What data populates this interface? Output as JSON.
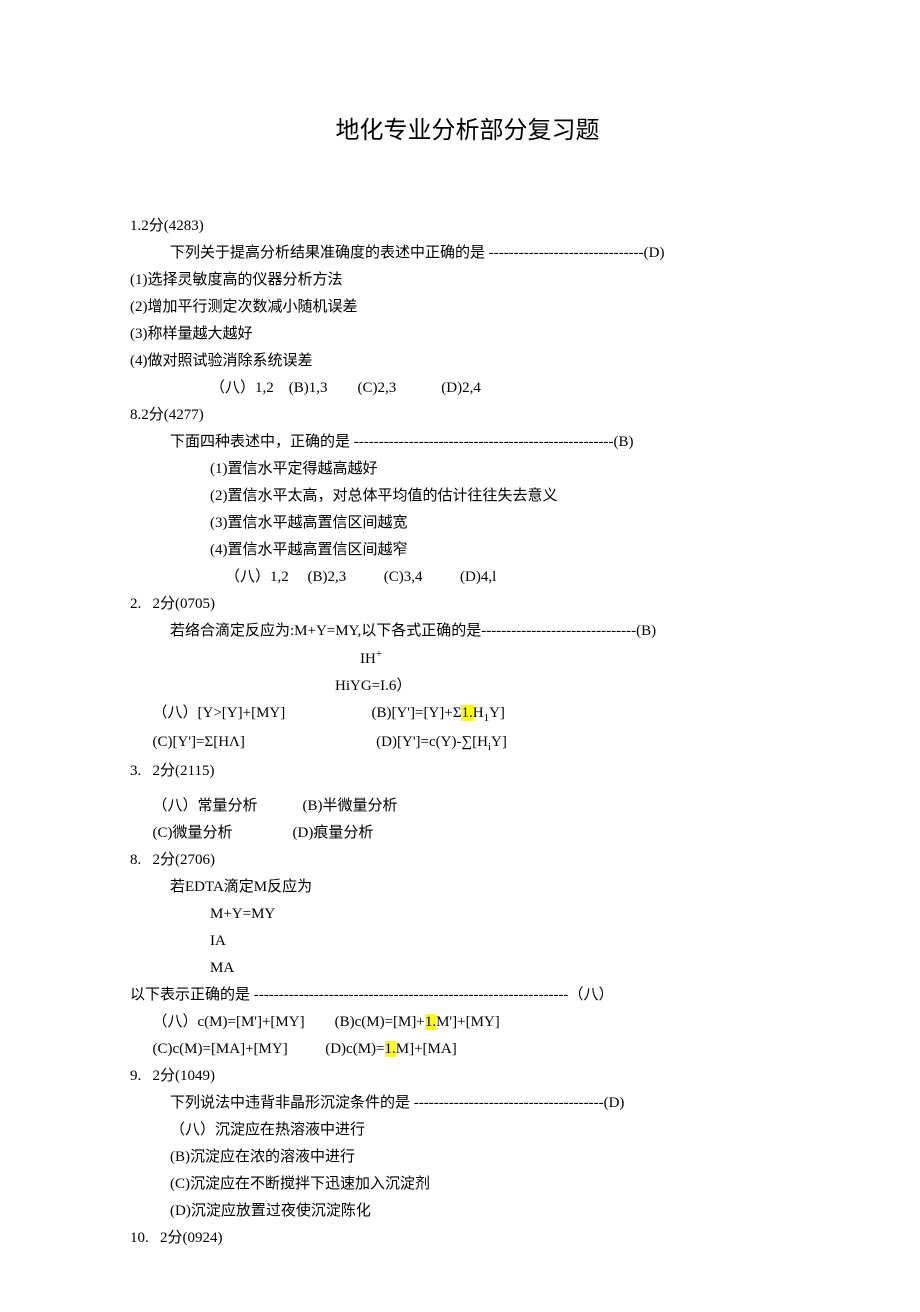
{
  "title": "地化专业分析部分复习题",
  "q1": {
    "header": "1.2分(4283)",
    "stem_prefix": "下列关于提高分析结果准确度的表述中正确的是 ",
    "stem_dash": "-------------------------------",
    "stem_ans": "(D)",
    "line1": "(1)选择灵敏度高的仪器分析方法",
    "line2": "(2)增加平行测定次数减小随机误差",
    "line3": "(3)称样量越大越好",
    "line4": "(4)做对照试验消除系统误差",
    "opts": "（八）1,2    (B)1,3        (C)2,3            (D)2,4"
  },
  "q8a": {
    "header": "8.2分(4277)",
    "stem_prefix": "下面四种表述中，正确的是 ",
    "stem_dash": "----------------------------------------------------",
    "stem_ans": "(B)",
    "line1": "(1)置信水平定得越高越好",
    "line2": "(2)置信水平太高，对总体平均值的估计往往失去意义",
    "line3": "(3)置信水平越高置信区间越宽",
    "line4": "(4)置信水平越高置信区间越窄",
    "opts": "（八）1,2     (B)2,3          (C)3,4          (D)4,l"
  },
  "q2": {
    "header": "2.   2分(0705)",
    "stem_prefix": "若络合滴定反应为:M+Y=MY,以下各式正确的是",
    "stem_dash": "-------------------------------",
    "stem_ans": "(B)",
    "mid1": "IH",
    "mid1_sup": "+",
    "mid2": "HiYG=I.6）",
    "optA_pre": "（八）[Y>[Y]+[MY]",
    "optB_pre": "(B)[Y']=[Y]+Σ",
    "optB_hl": "1.",
    "optB_post": "H",
    "optB_sub": "1",
    "optB_tail": "Y]",
    "optC": "(C)[Y']=Σ[HΛ]",
    "optD_pre": "(D)[Y']=c(Y)-∑[H",
    "optD_sub": "i",
    "optD_post": "Y]"
  },
  "q3": {
    "header": "3.   2分(2115)",
    "row1a": "（八）常量分析",
    "row1b": "(B)半微量分析",
    "row2a": "(C)微量分析",
    "row2b": "(D)痕量分析"
  },
  "q8b": {
    "header": "8.   2分(2706)",
    "stem": "若EDTA滴定M反应为",
    "l1": "M+Y=MY",
    "l2": "IA",
    "l3": "MA",
    "stem2_pre": "以下表示正确的是 ",
    "stem2_dash": "---------------------------------------------------------------",
    "stem2_ans": "（八）",
    "optA": "（八）c(M)=[M']+[MY]",
    "optB_pre": "(B)c(M)=[M]+",
    "optB_hl": "1.",
    "optB_post": "M']+[MY]",
    "optC": "(C)c(M)=[MA]+[MY]",
    "optD_pre": "(D)c(M)=",
    "optD_hl": "1.",
    "optD_post": "M]+[MA]"
  },
  "q9": {
    "header": "9.   2分(1049)",
    "stem_pre": "下列说法中违背非晶形沉淀条件的是 ",
    "stem_dash": "--------------------------------------",
    "stem_ans": "(D)",
    "a": "（八）沉淀应在热溶液中进行",
    "b": "(B)沉淀应在浓的溶液中进行",
    "c": "(C)沉淀应在不断搅拌下迅速加入沉淀剂",
    "d": "(D)沉淀应放置过夜使沉淀陈化"
  },
  "q10": {
    "header": "10.   2分(0924)"
  }
}
